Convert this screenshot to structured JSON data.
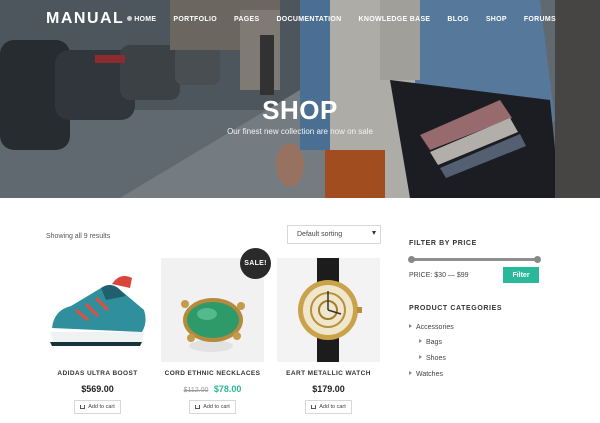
{
  "header": {
    "logo": "MANUAL",
    "nav": [
      "HOME",
      "PORTFOLIO",
      "PAGES",
      "DOCUMENTATION",
      "KNOWLEDGE BASE",
      "BLOG",
      "SHOP",
      "FORUMS"
    ]
  },
  "hero": {
    "title": "SHOP",
    "subtitle": "Our finest new collection are now on sale"
  },
  "shop": {
    "result_count": "Showing all 9 results",
    "sort_selected": "Default sorting",
    "sale_badge": "SALE!",
    "add_to_cart": "Add to cart",
    "products": [
      {
        "name": "ADIDAS ULTRA BOOST",
        "price": "$569.00"
      },
      {
        "name": "CORD ETHNIC NECKLACES",
        "old_price": "$112.00",
        "price": "$78.00"
      },
      {
        "name": "EART METALLIC WATCH",
        "price": "$179.00"
      }
    ]
  },
  "sidebar": {
    "filter_title": "FILTER BY PRICE",
    "price_label": "PRICE: $30 — $99",
    "filter_button": "Filter",
    "price_slider": {
      "min_fraction": 0.0,
      "max_fraction": 1.0
    },
    "categories_title": "PRODUCT CATEGORIES",
    "categories": [
      "Accessories",
      "Bags",
      "Shoes",
      "Watches"
    ]
  },
  "colors": {
    "accent": "#2ab89b",
    "badge": "#2a2a2a"
  }
}
